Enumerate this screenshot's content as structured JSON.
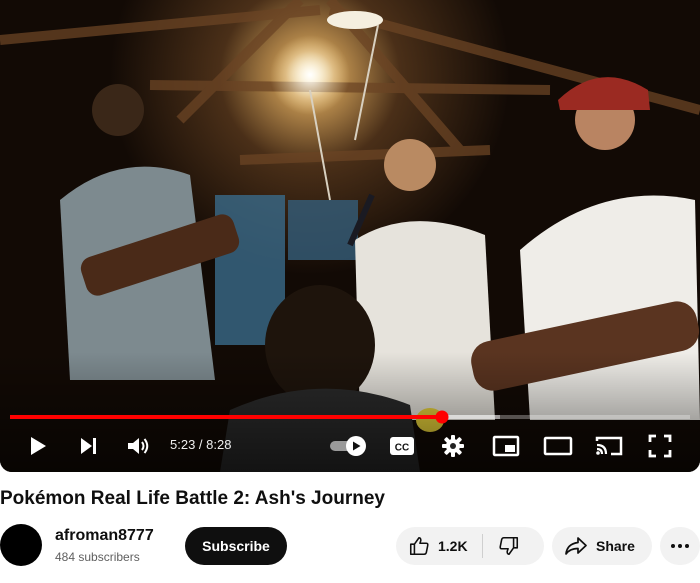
{
  "player": {
    "current_time": "5:23",
    "duration": "8:28",
    "time_display": "5:23 / 8:28",
    "played_fraction": 0.636,
    "buffered_fraction": 0.72,
    "cc_label": "CC"
  },
  "video": {
    "title": "Pokémon Real Life Battle 2: Ash's Journey"
  },
  "channel": {
    "name": "afroman8777",
    "subscribers": "484 subscribers"
  },
  "actions": {
    "subscribe_label": "Subscribe",
    "like_count": "1.2K",
    "share_label": "Share"
  },
  "colors": {
    "progress_played": "#ff0000",
    "subscribe_bg": "#0f0f0f",
    "pill_bg": "#f2f2f2"
  },
  "icons": [
    "play-icon",
    "next-icon",
    "volume-icon",
    "autoplay-toggle-icon",
    "captions-icon",
    "settings-gear-icon",
    "miniplayer-icon",
    "theater-mode-icon",
    "cast-icon",
    "fullscreen-icon",
    "thumbs-up-icon",
    "thumbs-down-icon",
    "share-arrow-icon",
    "more-dots-icon"
  ]
}
